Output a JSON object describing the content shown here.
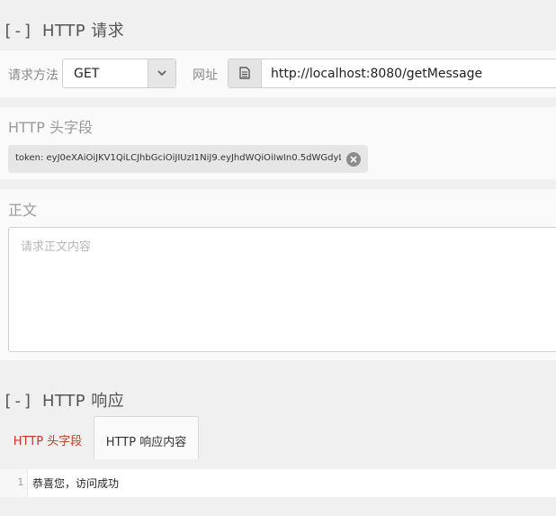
{
  "request_section": {
    "toggle": "[-]",
    "title": "HTTP 请求",
    "method_label": "请求方法",
    "method_value": "GET",
    "url_label": "网址",
    "url_value": "http://localhost:8080/getMessage",
    "headers_title": "HTTP 头字段",
    "header_chip": "token: eyJ0eXAiOiJKV1QiLCJhbGciOiJIUzI1NiJ9.eyJhdWQiOiIwIn0.5dWGdyL...",
    "body_title": "正文",
    "body_placeholder": "请求正文内容"
  },
  "response_section": {
    "toggle": "[-]",
    "title": "HTTP 响应",
    "tabs": [
      {
        "label": "HTTP 头字段",
        "active": false
      },
      {
        "label": "HTTP 响应内容",
        "active": true
      }
    ],
    "lines": [
      {
        "number": "1",
        "text": "恭喜您，访问成功"
      }
    ]
  },
  "colors": {
    "inactive_tab": "#c0392b",
    "page_background": "#f0f0f0",
    "panel_background": "#fafafa"
  },
  "icons": {
    "select_arrow": "chevron-down-icon",
    "url_addon": "document-icon",
    "chip_remove": "close-icon"
  }
}
